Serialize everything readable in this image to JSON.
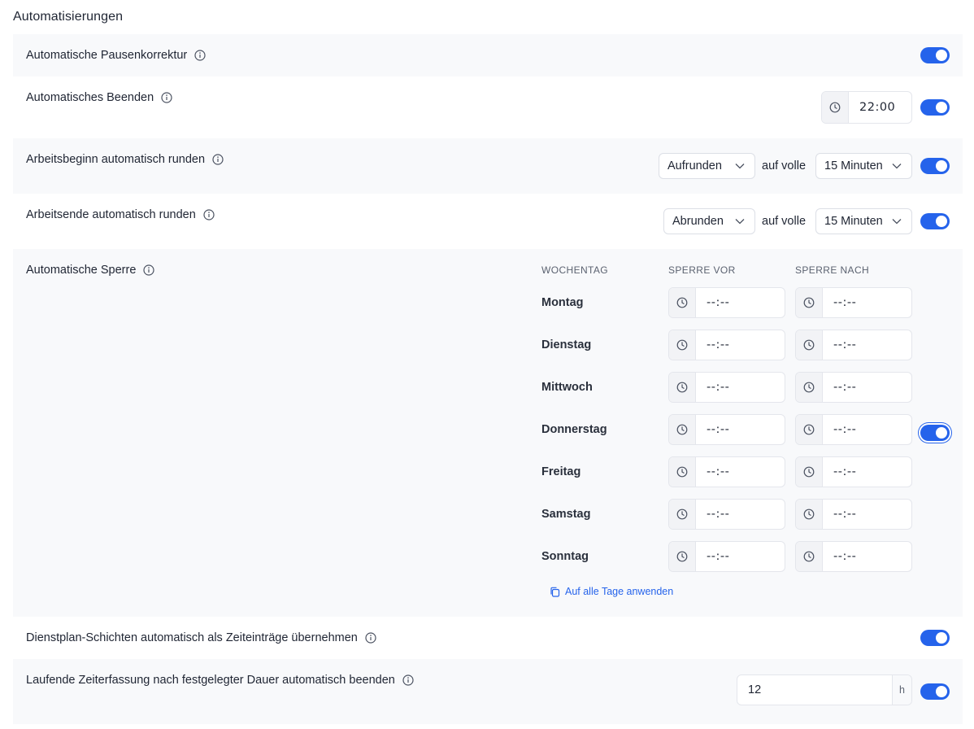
{
  "section_title": "Automatisierungen",
  "accent_color": "#2563eb",
  "rows": {
    "pause": {
      "label": "Automatische Pausenkorrektur",
      "enabled": true
    },
    "auto_end": {
      "label": "Automatisches Beenden",
      "time": "22:00",
      "enabled": true
    },
    "round_start": {
      "label": "Arbeitsbeginn automatisch runden",
      "mode": "Aufrunden",
      "connector": "auf volle",
      "interval": "15 Minuten",
      "enabled": true
    },
    "round_end": {
      "label": "Arbeitsende automatisch runden",
      "mode": "Abrunden",
      "connector": "auf volle",
      "interval": "15 Minuten",
      "enabled": true
    },
    "lock": {
      "label": "Automatische Sperre",
      "enabled": true,
      "headers": {
        "weekday": "WOCHENTAG",
        "lock_before": "SPERRE VOR",
        "lock_after": "SPERRE NACH"
      },
      "days": [
        {
          "name": "Montag",
          "before": "--:--",
          "after": "--:--"
        },
        {
          "name": "Dienstag",
          "before": "--:--",
          "after": "--:--"
        },
        {
          "name": "Mittwoch",
          "before": "--:--",
          "after": "--:--"
        },
        {
          "name": "Donnerstag",
          "before": "--:--",
          "after": "--:--"
        },
        {
          "name": "Freitag",
          "before": "--:--",
          "after": "--:--"
        },
        {
          "name": "Samstag",
          "before": "--:--",
          "after": "--:--"
        },
        {
          "name": "Sonntag",
          "before": "--:--",
          "after": "--:--"
        }
      ],
      "apply_all": "Auf alle Tage anwenden"
    },
    "roster": {
      "label": "Dienstplan-Schichten automatisch als Zeiteinträge übernehmen",
      "enabled": true
    },
    "running": {
      "label": "Laufende Zeiterfassung nach festgelegter Dauer automatisch beenden",
      "value": "12",
      "unit": "h",
      "enabled": true
    }
  },
  "icons": {
    "info": "info-icon",
    "clock": "clock-icon",
    "chevron": "chevron-down-icon",
    "copy": "copy-icon"
  }
}
